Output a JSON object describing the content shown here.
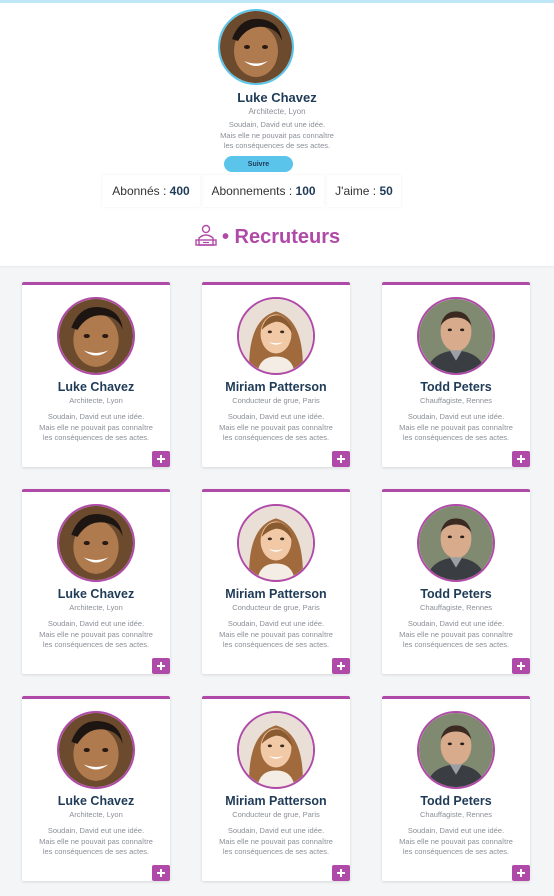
{
  "profile": {
    "name": "Luke Chavez",
    "subtitle": "Architecte, Lyon",
    "bio": [
      "Soudain, David eut une idée.",
      "Mais elle ne pouvait pas connaître",
      "les conséquences de ses actes."
    ],
    "follow_label": "Suivre",
    "stats": {
      "followers_label": "Abonnés :",
      "followers_value": "400",
      "following_label": "Abonnements :",
      "following_value": "100",
      "likes_label": "J'aime :",
      "likes_value": "50"
    }
  },
  "section": {
    "title": "• Recruteurs"
  },
  "colors": {
    "accent": "#b04aa8",
    "blue": "#5bc4ea",
    "name": "#1f3b57",
    "muted": "#8a8f96"
  },
  "cards": [
    {
      "name": "Luke Chavez",
      "subtitle": "Architecte, Lyon",
      "bio": [
        "Soudain, David eut une idée.",
        "Mais elle ne pouvait pas connaître",
        "les conséquences de ses actes."
      ]
    },
    {
      "name": "Miriam Patterson",
      "subtitle": "Conducteur de grue, Paris",
      "bio": [
        "Soudain, David eut une idée.",
        "Mais elle ne pouvait pas connaître",
        "les conséquences de ses actes."
      ]
    },
    {
      "name": "Todd Peters",
      "subtitle": "Chauffagiste, Rennes",
      "bio": [
        "Soudain, David eut une idée.",
        "Mais elle ne pouvait pas connaître",
        "les conséquences de ses actes."
      ]
    },
    {
      "name": "Luke Chavez",
      "subtitle": "Architecte, Lyon",
      "bio": [
        "Soudain, David eut une idée.",
        "Mais elle ne pouvait pas connaître",
        "les conséquences de ses actes."
      ]
    },
    {
      "name": "Miriam Patterson",
      "subtitle": "Conducteur de grue, Paris",
      "bio": [
        "Soudain, David eut une idée.",
        "Mais elle ne pouvait pas connaître",
        "les conséquences de ses actes."
      ]
    },
    {
      "name": "Todd Peters",
      "subtitle": "Chauffagiste, Rennes",
      "bio": [
        "Soudain, David eut une idée.",
        "Mais elle ne pouvait pas connaître",
        "les conséquences de ses actes."
      ]
    },
    {
      "name": "Luke Chavez",
      "subtitle": "Architecte, Lyon",
      "bio": [
        "Soudain, David eut une idée.",
        "Mais elle ne pouvait pas connaître",
        "les conséquences de ses actes."
      ]
    },
    {
      "name": "Miriam Patterson",
      "subtitle": "Conducteur de grue, Paris",
      "bio": [
        "Soudain, David eut une idée.",
        "Mais elle ne pouvait pas connaître",
        "les conséquences de ses actes."
      ]
    },
    {
      "name": "Todd Peters",
      "subtitle": "Chauffagiste, Rennes",
      "bio": [
        "Soudain, David eut une idée.",
        "Mais elle ne pouvait pas connaître",
        "les conséquences de ses actes."
      ]
    }
  ]
}
